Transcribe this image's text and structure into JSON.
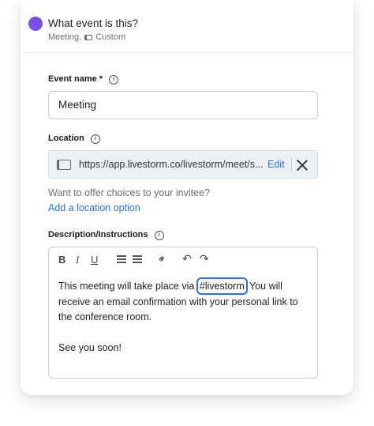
{
  "header": {
    "title": "What event is this?",
    "sub_type": "Meeting,",
    "sub_custom": "Custom",
    "dot_color": "#7b4fe0"
  },
  "event_name": {
    "label": "Event name *",
    "value": "Meeting"
  },
  "location": {
    "label": "Location",
    "url": "https://app.livestorm.co/livestorm/meet/s...",
    "edit_label": "Edit"
  },
  "offer": {
    "text": "Want to offer choices to your invitee?",
    "link": "Add a location option"
  },
  "description": {
    "label": "Description/Instructions",
    "toolbar": {
      "bold": "B",
      "italic": "I",
      "underline": "U"
    },
    "line1_before": "This meeting will take place via",
    "tag": "#livestorm",
    "line1_after": "You will receive an email confirmation with your personal link to the conference room.",
    "line2": "See you soon!"
  },
  "colors": {
    "accent": "#2f6fd6",
    "brand": "#7b4fe0"
  }
}
